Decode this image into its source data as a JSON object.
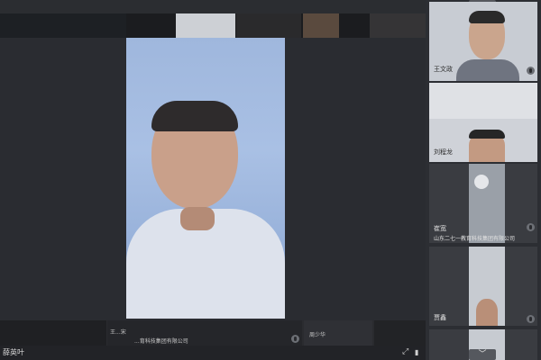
{
  "main_speaker": {
    "name": "薛英叶"
  },
  "bottom_strip": {
    "tiles": [
      {
        "label": ""
      },
      {
        "label": "王...宋"
      },
      {
        "label": "...育科技集团有限公司"
      },
      {
        "label": "周少华"
      },
      {
        "label": ""
      }
    ]
  },
  "right_panel": {
    "scroll_up_label": "︿",
    "scroll_down_label": "﹀",
    "participants": [
      {
        "name": "王文政",
        "org": ""
      },
      {
        "name": "刘程龙",
        "org": ""
      },
      {
        "name": "崔宽",
        "org": "山东二七一教育科技集团有限公司"
      },
      {
        "name": "贾鑫",
        "org": ""
      }
    ]
  },
  "footer": {
    "fullscreen_icon": "⤢",
    "mic_icon": "🎙"
  },
  "colors": {
    "background": "#232529",
    "panel": "#2c2e33",
    "tile": "#3a3c41",
    "text": "#e0e0e0",
    "main_video_sky": "#a9c0e4"
  },
  "icons": [
    "microphone-icon",
    "fullscreen-icon",
    "chevron-up-icon",
    "chevron-down-icon"
  ]
}
